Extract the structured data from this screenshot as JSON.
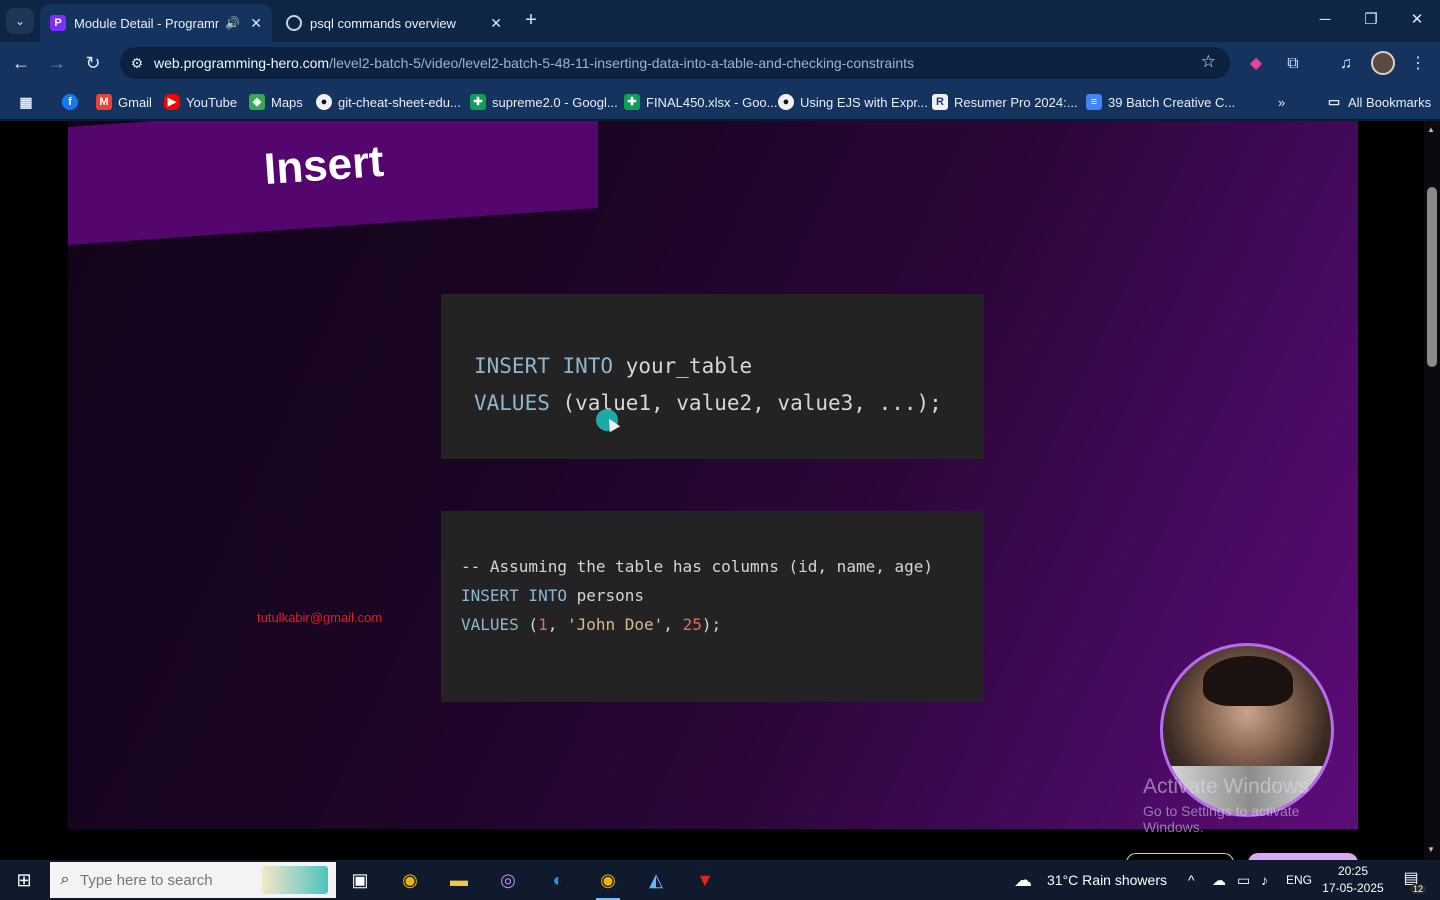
{
  "tabs": [
    {
      "title": "Module Detail - Programmi",
      "active": true
    },
    {
      "title": "psql commands overview",
      "active": false
    }
  ],
  "omnibox": {
    "host": "web.programming-hero.com",
    "path": "/level2-batch-5/video/level2-batch-5-48-11-inserting-data-into-a-table-and-checking-constraints"
  },
  "bookmarks": [
    {
      "label": "Gmail",
      "icon": "gmail-icon"
    },
    {
      "label": "YouTube",
      "icon": "youtube-icon"
    },
    {
      "label": "Maps",
      "icon": "maps-icon"
    },
    {
      "label": "git-cheat-sheet-edu...",
      "icon": "github-icon"
    },
    {
      "label": "supreme2.0 - Googl...",
      "icon": "sheets-icon"
    },
    {
      "label": "FINAL450.xlsx - Goo...",
      "icon": "sheets-icon"
    },
    {
      "label": "Using EJS with Expr...",
      "icon": "github-icon"
    },
    {
      "label": "Resumer Pro 2024:...",
      "icon": "resumer-icon"
    },
    {
      "label": "39 Batch Creative C...",
      "icon": "docs-icon"
    }
  ],
  "all_bookmarks": "All Bookmarks",
  "slide": {
    "title": "Insert",
    "code1": {
      "line1": {
        "kw": "INSERT INTO",
        "rest": " your_table"
      },
      "line2": {
        "kw": "VALUES",
        "rest": " (value1, value2, value3, ...);"
      }
    },
    "code2": {
      "comment": "-- Assuming the table has columns (id, name, age)",
      "line2": {
        "kw": "INSERT INTO",
        "rest": " persons"
      },
      "line3": {
        "kw": "VALUES",
        "p1": " (",
        "n1": "1",
        "c1": ", ",
        "s1": "'John Doe'",
        "c2": ", ",
        "n2": "25",
        "end": ");"
      }
    },
    "email_watermark": "tutulkabir@gmail.com"
  },
  "activate_windows": {
    "line1": "Activate Windows",
    "line2": "Go to Settings to activate Windows."
  },
  "taskbar": {
    "search_placeholder": "Type here to search",
    "weather": "31°C  Rain showers",
    "language": "ENG",
    "time": "20:25",
    "date": "17-05-2025",
    "notification_count": "12"
  }
}
